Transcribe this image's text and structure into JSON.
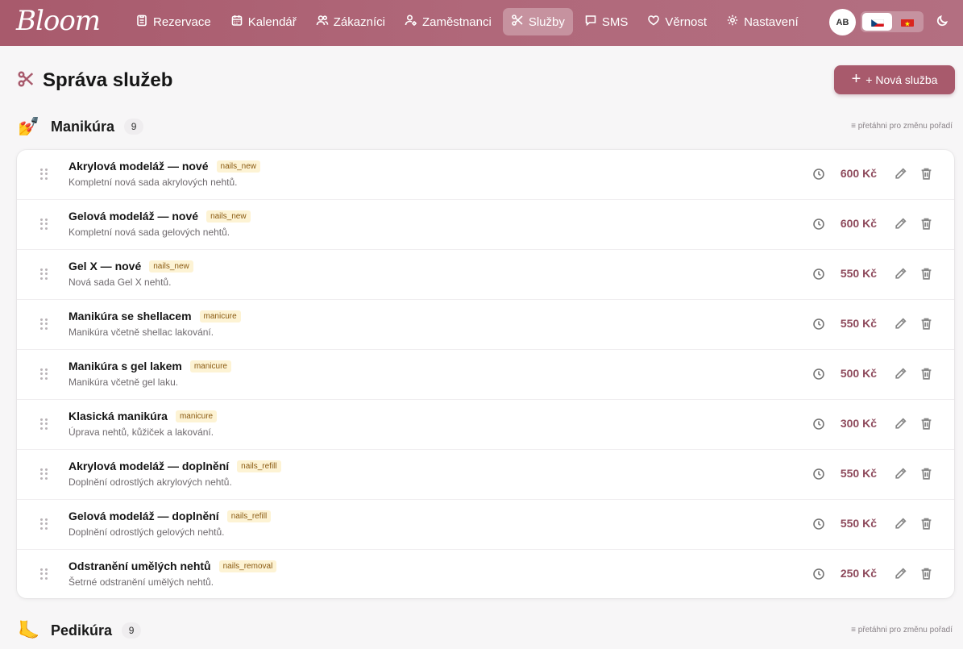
{
  "app": {
    "logo_text": "Bloom"
  },
  "nav": {
    "items": [
      {
        "label": "Rezervace",
        "icon": "clipboard-icon",
        "active": false
      },
      {
        "label": "Kalendář",
        "icon": "calendar-icon",
        "active": false
      },
      {
        "label": "Zákazníci",
        "icon": "users-icon",
        "active": false
      },
      {
        "label": "Zaměstnanci",
        "icon": "user-cog-icon",
        "active": false
      },
      {
        "label": "Služby",
        "icon": "scissors-icon",
        "active": true
      },
      {
        "label": "SMS",
        "icon": "message-icon",
        "active": false
      },
      {
        "label": "Věrnost",
        "icon": "heart-icon",
        "active": false
      },
      {
        "label": "Nastavení",
        "icon": "gear-icon",
        "active": false
      }
    ],
    "avatar_initials": "AB",
    "languages": [
      {
        "code": "cs",
        "icon": "czech-flag-icon",
        "active": true
      },
      {
        "code": "vi",
        "icon": "vietnam-flag-icon",
        "active": false
      }
    ],
    "theme_icon": "moon-icon"
  },
  "page": {
    "title": "Správa služeb",
    "title_icon": "scissors-icon",
    "new_button_label": "+ Nová služba"
  },
  "sections": [
    {
      "emoji": "💅",
      "name": "Manikúra",
      "count": "9",
      "drag_hint": "≡ přetáhni pro změnu pořadí",
      "services": [
        {
          "name": "Akrylová modeláž — nové",
          "tag": "nails_new",
          "desc": "Kompletní nová sada akrylových nehtů.",
          "price": "600 Kč"
        },
        {
          "name": "Gelová modeláž — nové",
          "tag": "nails_new",
          "desc": "Kompletní nová sada gelových nehtů.",
          "price": "600 Kč"
        },
        {
          "name": "Gel X — nové",
          "tag": "nails_new",
          "desc": "Nová sada Gel X nehtů.",
          "price": "550 Kč"
        },
        {
          "name": "Manikúra se shellacem",
          "tag": "manicure",
          "desc": "Manikúra včetně shellac lakování.",
          "price": "550 Kč"
        },
        {
          "name": "Manikúra s gel lakem",
          "tag": "manicure",
          "desc": "Manikúra včetně gel laku.",
          "price": "500 Kč"
        },
        {
          "name": "Klasická manikúra",
          "tag": "manicure",
          "desc": "Úprava nehtů, kůžiček a lakování.",
          "price": "300 Kč"
        },
        {
          "name": "Akrylová modeláž — doplnění",
          "tag": "nails_refill",
          "desc": "Doplnění odrostlých akrylových nehtů.",
          "price": "550 Kč"
        },
        {
          "name": "Gelová modeláž — doplnění",
          "tag": "nails_refill",
          "desc": "Doplnění odrostlých gelových nehtů.",
          "price": "550 Kč"
        },
        {
          "name": "Odstranění umělých nehtů",
          "tag": "nails_removal",
          "desc": "Šetrné odstranění umělých nehtů.",
          "price": "250 Kč"
        }
      ]
    },
    {
      "emoji": "🦶",
      "name": "Pedikúra",
      "count": "9",
      "drag_hint": "≡ přetáhni pro změnu pořadí",
      "services": []
    }
  ]
}
